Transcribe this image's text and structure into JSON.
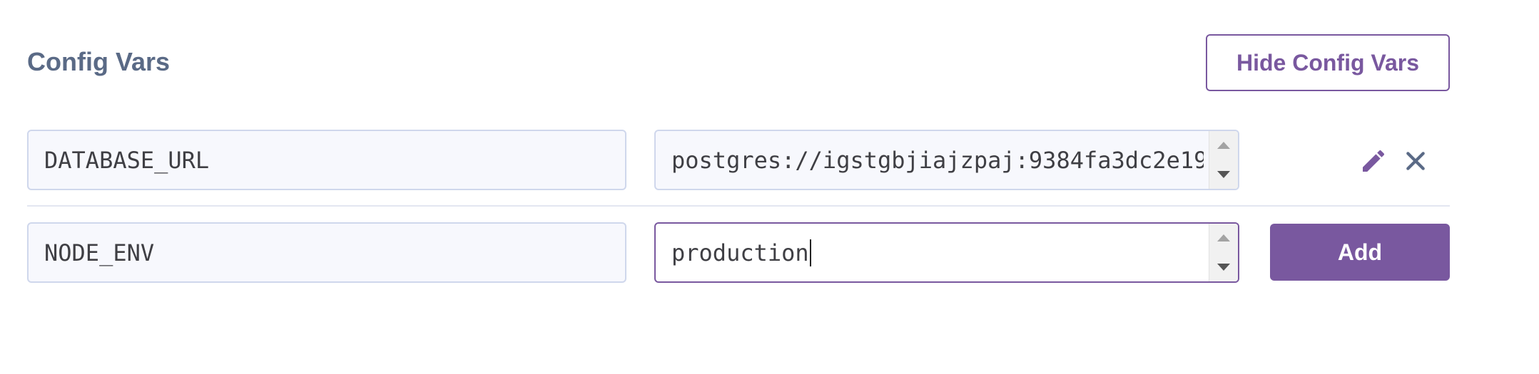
{
  "section": {
    "title": "Config Vars",
    "toggle_label": "Hide Config Vars"
  },
  "vars": [
    {
      "key": "DATABASE_URL",
      "value": "postgres://igstgbjiajzpaj:9384fa3dc2e19"
    }
  ],
  "new_var": {
    "key": "NODE_ENV",
    "value": "production",
    "add_label": "Add"
  },
  "icons": {
    "edit": "pencil-icon",
    "delete": "close-icon"
  },
  "colors": {
    "accent": "#79589f",
    "title": "#5a6a86",
    "field_border": "#cfd7ec",
    "field_bg": "#f7f8fd"
  }
}
